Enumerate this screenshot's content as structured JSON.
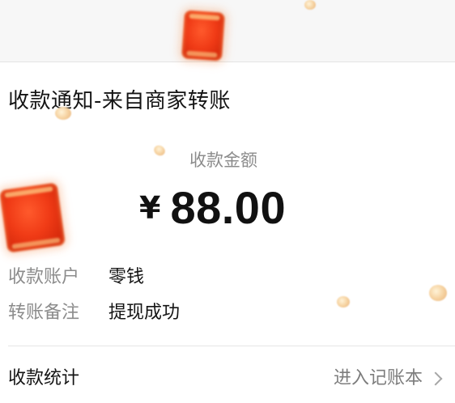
{
  "notification": {
    "title": "收款通知-来自商家转账"
  },
  "amount": {
    "label": "收款金额",
    "currency_symbol": "¥",
    "value": "88.00"
  },
  "details": [
    {
      "label": "收款账户",
      "value": "零钱"
    },
    {
      "label": "转账备注",
      "value": "提现成功"
    }
  ],
  "stats": {
    "label": "收款统计",
    "link_label": "进入记账本",
    "icon": "chevron-right-icon"
  },
  "decorations": {
    "envelope_icon": "red-envelope-icon",
    "coin_icon": "coin-icon",
    "envelope_color": "#f03b16",
    "coin_color": "#f6d3a2"
  }
}
